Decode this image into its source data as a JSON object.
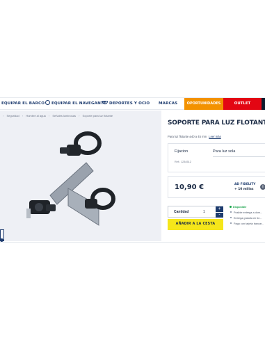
{
  "nav": {
    "items": [
      {
        "label": "EQUIPAR EL BARCO",
        "icon": "none"
      },
      {
        "label": "EQUIPAR EL NAVEGANTE",
        "icon": "person-icon"
      },
      {
        "label": "DEPORTES Y OCIO",
        "icon": "boat-icon"
      },
      {
        "label": "MARCAS",
        "icon": "none"
      }
    ],
    "promo": "OPORTUNIDADES",
    "sale": "OUTLET",
    "colors": {
      "promo": "#f39200",
      "sale": "#e30613",
      "nav_text": "#1d3b6e"
    }
  },
  "breadcrumb": [
    "Seguridad",
    "Hombre al agua",
    "Señales luminosas",
    "Soporte para luz flotante"
  ],
  "product": {
    "title": "SOPORTE PARA LUZ FLOTANTE",
    "subtitle": "Para luz flotante ø40 a 45 mm",
    "more_link": "Leer más",
    "spec": {
      "label": "Fijacion",
      "value": "Para luz sola",
      "ref": "Ref.: 1234512"
    },
    "price": "10,90 €",
    "fidelity": {
      "title": "AD FIDELITY",
      "miles": "+ 10 millas"
    },
    "quantity": {
      "label": "Cantidad",
      "value": "1",
      "plus": "+",
      "minus": "-"
    },
    "add_button": "AÑADIR A LA CESTA",
    "availability": {
      "status": "Disponible",
      "notes": [
        "Posible entrega a dom...",
        "Entrega gratuita en tie...",
        "Pago con tarjeta bancar..."
      ]
    }
  },
  "icons": {
    "info": "i"
  }
}
